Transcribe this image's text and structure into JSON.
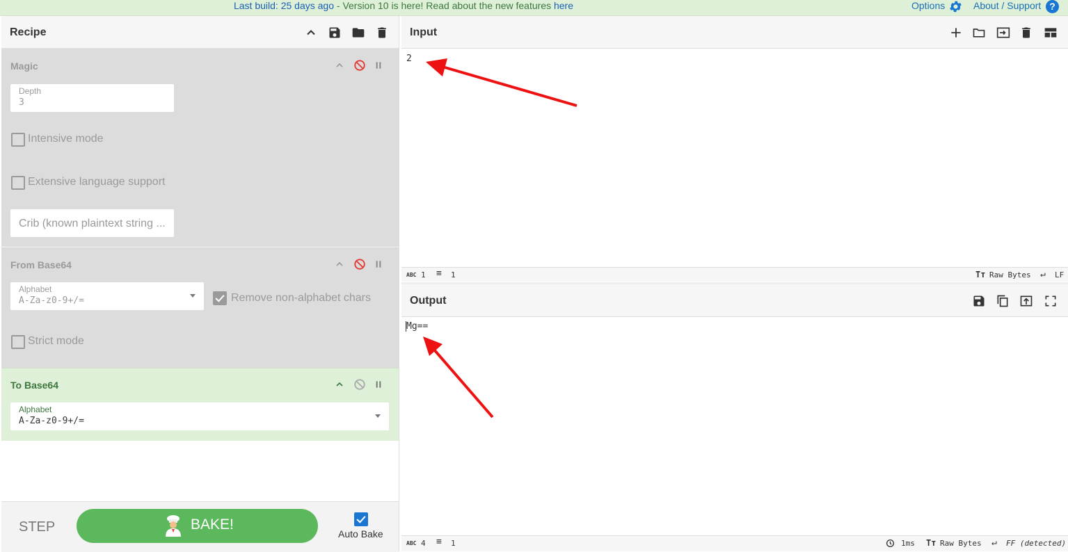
{
  "banner": {
    "last_build": "Last build: 25 days ago",
    "separator": " - ",
    "version_notice": "Version 10 is here! Read about the new features ",
    "here_link": "here",
    "options": "Options",
    "about": "About / Support",
    "help_glyph": "?",
    "bg_color": "#dff0d8"
  },
  "recipe": {
    "title": "Recipe",
    "operations": [
      {
        "name": "Magic",
        "depth_label": "Depth",
        "depth_value": "3",
        "intensive_label": "Intensive mode",
        "extensive_label": "Extensive language support",
        "crib_placeholder": "Crib (known plaintext string ..."
      },
      {
        "name": "From Base64",
        "alphabet_label": "Alphabet",
        "alphabet_value": "A-Za-z0-9+/=",
        "remove_label": "Remove non-alphabet chars",
        "strict_label": "Strict mode"
      },
      {
        "name": "To Base64",
        "alphabet_label": "Alphabet",
        "alphabet_value": "A-Za-z0-9+/="
      }
    ]
  },
  "bake": {
    "step_label": "STEP",
    "bake_label": "BAKE!",
    "autobake_label": "Auto Bake",
    "bake_color": "#5cb85c"
  },
  "input": {
    "title": "Input",
    "text": "2",
    "length": "1",
    "lines": "1",
    "encoding": "Raw Bytes",
    "eol": "LF"
  },
  "output": {
    "title": "Output",
    "text": "Mg==",
    "length": "4",
    "lines": "1",
    "time": "1ms",
    "encoding": "Raw Bytes",
    "eol": "FF (detected)"
  },
  "colors": {
    "accent_blue": "#1976d2",
    "disabled_red": "#e53935",
    "active_green": "#3c763d",
    "arrow_red": "#ee1111"
  }
}
